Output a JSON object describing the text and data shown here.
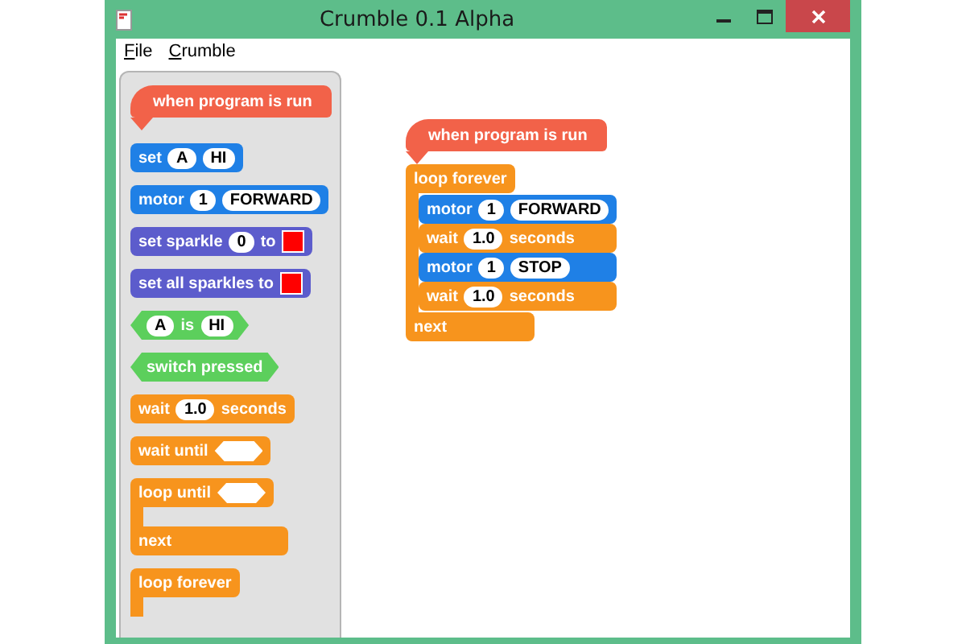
{
  "window": {
    "title": "Crumble 0.1 Alpha"
  },
  "menu": [
    {
      "label": "File"
    },
    {
      "label": "Crumble"
    }
  ],
  "palette": [
    {
      "kind": "hat",
      "color": "#f26249",
      "parts": [
        {
          "kind": "text",
          "text": "when program is run"
        }
      ]
    },
    {
      "kind": "command",
      "color": "#1f80e6",
      "parts": [
        {
          "kind": "text",
          "text": "set"
        },
        {
          "kind": "pill",
          "text": "A"
        },
        {
          "kind": "pill",
          "text": "HI"
        }
      ]
    },
    {
      "kind": "command",
      "color": "#1f80e6",
      "parts": [
        {
          "kind": "text",
          "text": "motor"
        },
        {
          "kind": "pill",
          "text": "1"
        },
        {
          "kind": "pill",
          "text": "FORWARD"
        }
      ]
    },
    {
      "kind": "command",
      "color": "#5c5ccc",
      "parts": [
        {
          "kind": "text",
          "text": "set sparkle"
        },
        {
          "kind": "pill",
          "text": "0"
        },
        {
          "kind": "text",
          "text": "to"
        },
        {
          "kind": "swatch",
          "color": "#ff0000"
        }
      ]
    },
    {
      "kind": "command",
      "color": "#5c5ccc",
      "parts": [
        {
          "kind": "text",
          "text": "set all sparkles to"
        },
        {
          "kind": "swatch",
          "color": "#ff0000"
        }
      ]
    },
    {
      "kind": "boolean",
      "color": "#5ccf5c",
      "parts": [
        {
          "kind": "pill",
          "text": "A"
        },
        {
          "kind": "text",
          "text": "is"
        },
        {
          "kind": "pill",
          "text": "HI"
        }
      ]
    },
    {
      "kind": "boolean",
      "color": "#5ccf5c",
      "parts": [
        {
          "kind": "text",
          "text": "switch pressed"
        }
      ]
    },
    {
      "kind": "command",
      "color": "#f7941d",
      "parts": [
        {
          "kind": "text",
          "text": "wait"
        },
        {
          "kind": "pill",
          "text": "1.0"
        },
        {
          "kind": "text",
          "text": "seconds"
        }
      ]
    },
    {
      "kind": "command",
      "color": "#f7941d",
      "parts": [
        {
          "kind": "text",
          "text": "wait until"
        },
        {
          "kind": "slot"
        }
      ]
    },
    {
      "kind": "c",
      "color": "#f7941d",
      "parts": [
        {
          "kind": "text",
          "text": "loop until"
        },
        {
          "kind": "slot"
        }
      ],
      "footer": "next"
    },
    {
      "kind": "c",
      "color": "#f7941d",
      "parts": [
        {
          "kind": "text",
          "text": "loop forever"
        }
      ]
    }
  ],
  "script": [
    {
      "kind": "hat",
      "color": "#f26249",
      "parts": [
        {
          "kind": "text",
          "text": "when program is run"
        }
      ]
    },
    {
      "kind": "c",
      "color": "#f7941d",
      "parts": [
        {
          "kind": "text",
          "text": "loop forever"
        }
      ],
      "footer": "next",
      "children": [
        {
          "kind": "command",
          "color": "#1f80e6",
          "parts": [
            {
              "kind": "text",
              "text": "motor"
            },
            {
              "kind": "pill",
              "text": "1"
            },
            {
              "kind": "pill",
              "text": "FORWARD"
            }
          ]
        },
        {
          "kind": "command",
          "color": "#f7941d",
          "parts": [
            {
              "kind": "text",
              "text": "wait"
            },
            {
              "kind": "pill",
              "text": "1.0"
            },
            {
              "kind": "text",
              "text": "seconds"
            }
          ]
        },
        {
          "kind": "command",
          "color": "#1f80e6",
          "parts": [
            {
              "kind": "text",
              "text": "motor"
            },
            {
              "kind": "pill",
              "text": "1"
            },
            {
              "kind": "pill",
              "text": "STOP"
            }
          ]
        },
        {
          "kind": "command",
          "color": "#f7941d",
          "parts": [
            {
              "kind": "text",
              "text": "wait"
            },
            {
              "kind": "pill",
              "text": "1.0"
            },
            {
              "kind": "text",
              "text": "seconds"
            }
          ]
        }
      ]
    }
  ]
}
